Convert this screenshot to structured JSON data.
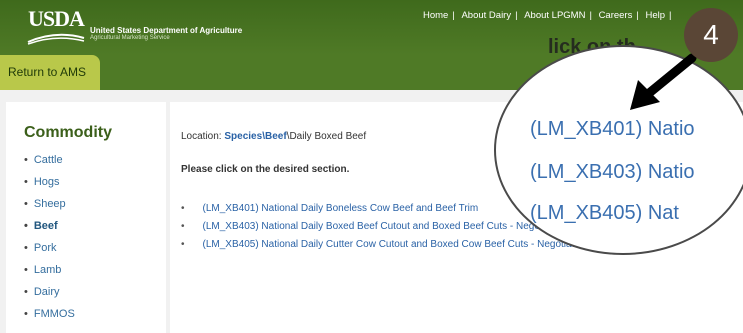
{
  "header": {
    "logo_text": "USDA",
    "agency_name": "United States Department of Agriculture",
    "agency_sub": "Agricultural Marketing Service",
    "return_label": "Return to AMS",
    "hint_text": "lick on th",
    "nav": [
      "Home",
      "About Dairy",
      "About LPGMN",
      "Careers",
      "Help"
    ],
    "nav_separator": "|"
  },
  "sidebar": {
    "title": "Commodity",
    "items": [
      {
        "label": "Cattle"
      },
      {
        "label": "Hogs"
      },
      {
        "label": "Sheep"
      },
      {
        "label": "Beef"
      },
      {
        "label": "Pork"
      },
      {
        "label": "Lamb"
      },
      {
        "label": "Dairy"
      },
      {
        "label": "FMMOS"
      }
    ]
  },
  "main": {
    "location_label": "Location:",
    "crumb_1": "Species",
    "crumb_sep": "\\",
    "crumb_2": "Beef",
    "crumb_3": "Daily Boxed Beef",
    "instruction": "Please click on the desired section.",
    "links": [
      {
        "label": "(LM_XB401) National Daily Boneless Cow Beef and Beef Trim"
      },
      {
        "label": "(LM_XB403) National Daily Boxed Beef Cutout and Boxed Beef Cuts - Negotiated - Afternoon"
      },
      {
        "label": "(LM_XB405) National Daily Cutter Cow Cutout and Boxed Cow Beef Cuts - Negotiated - Afternoon"
      }
    ]
  },
  "magnifier": {
    "items": [
      "(LM_XB401) Natio",
      "(LM_XB403) Natio",
      "(LM_XB405) Nat"
    ]
  },
  "annotation": {
    "step_number": "4"
  },
  "colors": {
    "header_green": "#4f7a26",
    "return_button": "#b9c84a",
    "link_blue": "#2a62a6",
    "sidebar_title_green": "#3b5f1a",
    "step_badge": "#5a4636"
  },
  "icons": {
    "logo": "usda-logo-icon",
    "pointer": "black-arrow-icon"
  }
}
